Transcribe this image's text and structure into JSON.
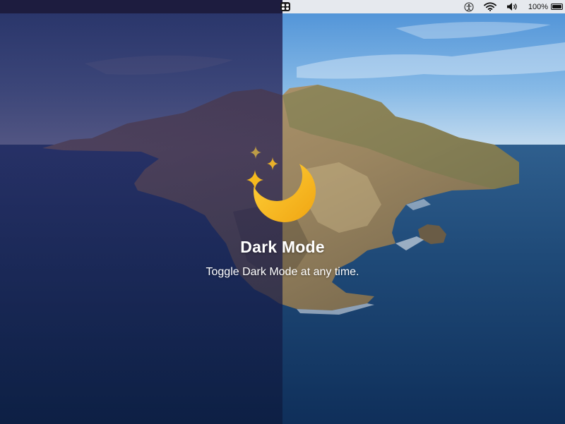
{
  "menubar": {
    "battery_percent": "100%",
    "icons": [
      "app-icon",
      "accessibility-icon",
      "wifi-icon",
      "volume-icon",
      "battery-icon"
    ]
  },
  "hero": {
    "title": "Dark Mode",
    "subtitle": "Toggle Dark Mode at any time."
  },
  "colors": {
    "moon": "#F5B91E",
    "sparkle": "#E8B02A",
    "dark_tint": "#1C1A3C"
  }
}
